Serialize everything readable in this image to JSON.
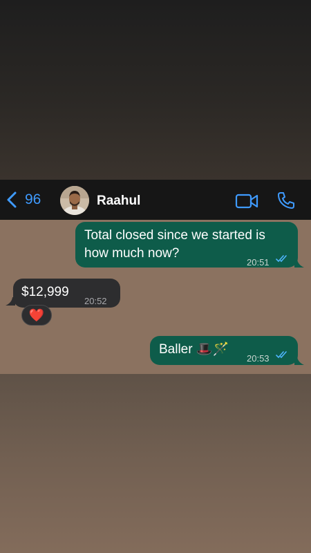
{
  "header": {
    "back_count": "96",
    "contact_name": "Raahul"
  },
  "messages": [
    {
      "direction": "outgoing",
      "text_line1": "Total closed since we started is",
      "text_line2": "how much now?",
      "time": "20:51",
      "status": "read"
    },
    {
      "direction": "incoming",
      "text": "$12,999",
      "time": "20:52",
      "reaction": "❤️"
    },
    {
      "direction": "outgoing",
      "text": "Baller 🎩🪄",
      "time": "20:53",
      "status": "read"
    }
  ],
  "colors": {
    "accent": "#3f9bff",
    "outgoing_bubble": "#0e5c4a",
    "incoming_bubble": "#2d2d2f",
    "wallpaper": "#8b7260",
    "header_bg": "#161616"
  },
  "icons": {
    "back": "chevron-left-icon",
    "video": "video-camera-icon",
    "call": "phone-icon",
    "read_receipt": "double-check-icon"
  }
}
